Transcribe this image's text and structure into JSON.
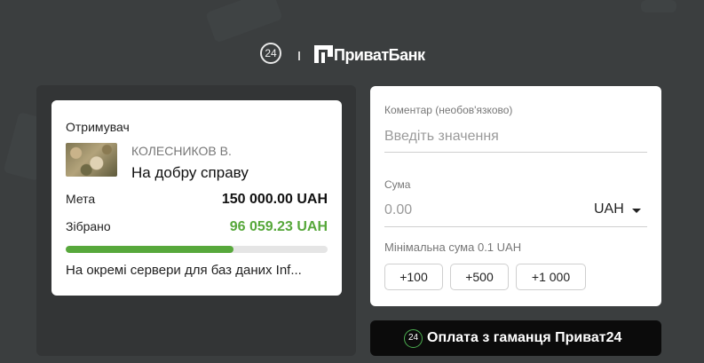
{
  "header": {
    "badge_text": "24",
    "brand_name": "ПриватБанк"
  },
  "recipient_card": {
    "title": "Отримувач",
    "owner_name": "КОЛЕСНИКОВ В.",
    "jar_name": "На добру справу",
    "goal_label": "Мета",
    "goal_value": "150 000.00 UAH",
    "collected_label": "Зібрано",
    "collected_value": "96 059.23 UAH",
    "progress_fraction": 0.64,
    "description": "На окремі сервери для баз даних Inf..."
  },
  "form": {
    "comment_label": "Коментар (необов'язково)",
    "comment_placeholder": "Введіть значення",
    "amount_label": "Сума",
    "amount_placeholder": "0.00",
    "currency": "UAH",
    "min_amount_text": "Мінімальна сума 0.1 UAH",
    "quick_amounts": [
      "+100",
      "+500",
      "+1 000"
    ]
  },
  "pay_button": {
    "badge_text": "24",
    "label": "Оплата з гаманця Приват24"
  },
  "colors": {
    "background": "#3b3e3f",
    "accent_green": "#57a83b",
    "pay_button_bg": "#0b0b0b"
  }
}
